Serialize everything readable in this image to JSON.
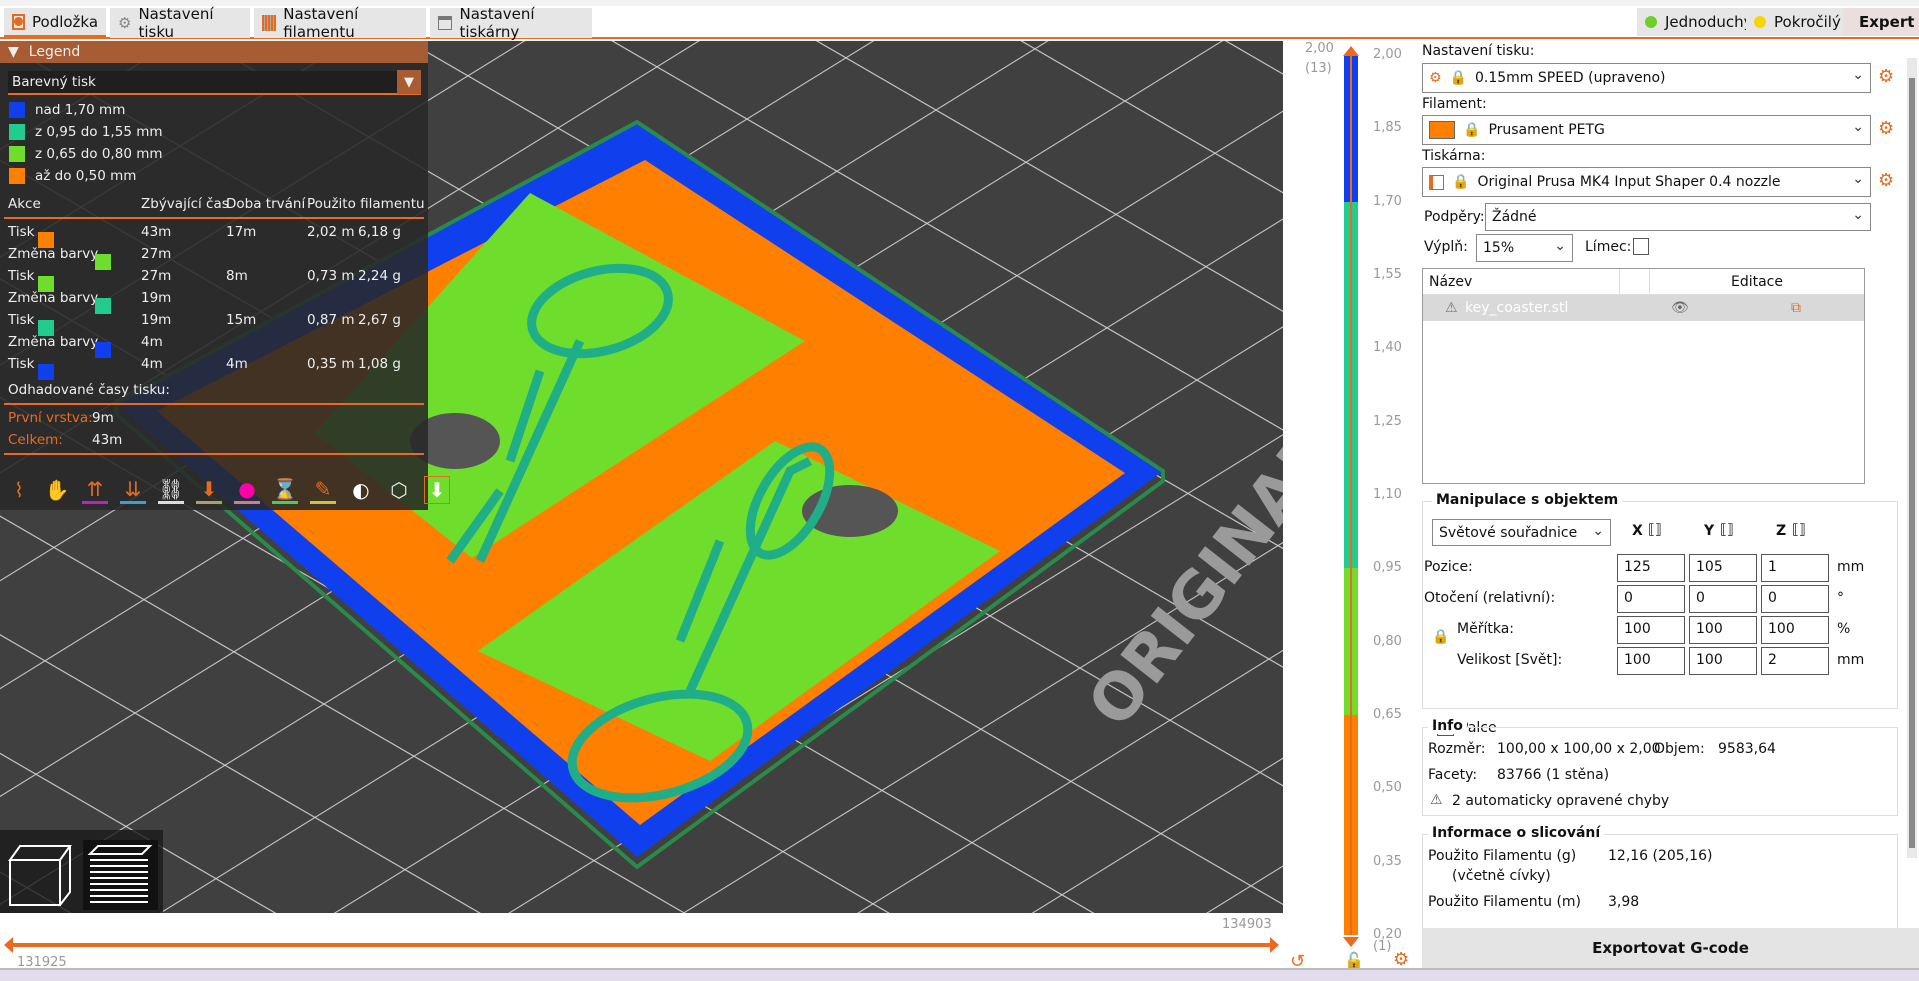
{
  "tabs": [
    {
      "label": "Podložka",
      "icon": "plate-icon"
    },
    {
      "label": "Nastavení tisku",
      "icon": "gear-icon"
    },
    {
      "label": "Nastavení filamentu",
      "icon": "spool-icon"
    },
    {
      "label": "Nastavení tiskárny",
      "icon": "printer-icon"
    }
  ],
  "modes": [
    {
      "label": "Jednoduchý",
      "color": "#6fce2e"
    },
    {
      "label": "Pokročilý",
      "color": "#f5d400"
    },
    {
      "label": "Expert",
      "color": "#e00000"
    }
  ],
  "legend": {
    "title": "Legend",
    "view_type": "Barevný tisk",
    "ranges": [
      {
        "label": "nad 1,70 mm",
        "color": "#1040ee"
      },
      {
        "label": "z 0,95 do 1,55 mm",
        "color": "#22cc8e"
      },
      {
        "label": "z 0,65 do 0,80 mm",
        "color": "#6fdd2c"
      },
      {
        "label": "až do 0,50 mm",
        "color": "#ff7f00"
      }
    ],
    "headers": [
      "Akce",
      "Zbývající čas",
      "Doba trvání",
      "Použito filamentu"
    ],
    "rows": [
      {
        "action": "Tisk",
        "colors": [
          "#ff7f00"
        ],
        "remaining": "43m",
        "duration": "17m",
        "length": "2,02 m",
        "weight": "6,18 g"
      },
      {
        "action": "Změna barvy",
        "colors": [
          "#ff7f00",
          "#6fdd2c"
        ],
        "remaining": "27m",
        "duration": "",
        "length": "",
        "weight": ""
      },
      {
        "action": "Tisk",
        "colors": [
          "#6fdd2c"
        ],
        "remaining": "27m",
        "duration": "8m",
        "length": "0,73 m",
        "weight": "2,24 g"
      },
      {
        "action": "Změna barvy",
        "colors": [
          "#6fdd2c",
          "#22cc8e"
        ],
        "remaining": "19m",
        "duration": "",
        "length": "",
        "weight": ""
      },
      {
        "action": "Tisk",
        "colors": [
          "#22cc8e"
        ],
        "remaining": "19m",
        "duration": "15m",
        "length": "0,87 m",
        "weight": "2,67 g"
      },
      {
        "action": "Změna barvy",
        "colors": [
          "#22cc8e",
          "#1040ee"
        ],
        "remaining": "4m",
        "duration": "",
        "length": "",
        "weight": ""
      },
      {
        "action": "Tisk",
        "colors": [
          "#1040ee"
        ],
        "remaining": "4m",
        "duration": "4m",
        "length": "0,35 m",
        "weight": "1,08 g"
      }
    ],
    "estimated_label": "Odhadované časy tisku:",
    "first_layer_label": "První vrstva:",
    "first_layer": "9m",
    "total_label": "Celkem:",
    "total": "43m"
  },
  "vertical_slider": {
    "top_value": "2,00",
    "top_layer": "(13)",
    "bottom_value": "0,20",
    "bottom_layer": "(1)",
    "ticks": [
      "2,00",
      "1,85",
      "1,70",
      "1,55",
      "1,40",
      "1,25",
      "1,10",
      "0,95",
      "0,80",
      "0,65",
      "0,50",
      "0,35",
      "0,20"
    ]
  },
  "horizontal_slider": {
    "left": "131925",
    "right": "134903"
  },
  "right": {
    "print_settings_label": "Nastavení tisku:",
    "print_settings": "0.15mm SPEED (upraveno)",
    "filament_label": "Filament:",
    "filament": "Prusament PETG",
    "filament_color": "#ff7f00",
    "printer_label": "Tiskárna:",
    "printer": "Original Prusa MK4 Input Shaper 0.4 nozzle",
    "supports_label": "Podpěry:",
    "supports": "Žádné",
    "infill_label": "Výplň:",
    "infill": "15%",
    "brim_label": "Límec:",
    "list_headers": {
      "name": "Název",
      "edit": "Editace"
    },
    "objects": [
      {
        "name": "key_coaster.stl"
      }
    ],
    "manip": {
      "title": "Manipulace s objektem",
      "coords": "Světové souřadnice",
      "axes": [
        "X",
        "Y",
        "Z"
      ],
      "rows": [
        {
          "label": "Pozice:",
          "values": [
            "125",
            "105",
            "1"
          ],
          "unit": "mm"
        },
        {
          "label": "Otočení (relativní):",
          "values": [
            "0",
            "0",
            "0"
          ],
          "unit": "°"
        },
        {
          "label": "Měřítka:",
          "values": [
            "100",
            "100",
            "100"
          ],
          "unit": "%"
        },
        {
          "label": "Velikost [Svět]:",
          "values": [
            "100",
            "100",
            "2"
          ],
          "unit": "mm"
        }
      ],
      "inches": "Palce"
    },
    "info": {
      "title": "Info",
      "size_label": "Rozměr:",
      "size": "100,00 x 100,00 x 2,00",
      "volume_label": "Objem:",
      "volume": "9583,64",
      "facets_label": "Facety:",
      "facets": "83766 (1 stěna)",
      "warning": "2 automaticky opravené chyby"
    },
    "slice": {
      "title": "Informace o slicování",
      "g_label": "Použito Filamentu (g)",
      "g_sub": "(včetně cívky)",
      "g": "12,16 (205,16)",
      "m_label": "Použito Filamentu (m)",
      "m": "3,98"
    },
    "export": "Exportovat G-code"
  },
  "canvas": {
    "bed_text": "ORIGINAL"
  }
}
